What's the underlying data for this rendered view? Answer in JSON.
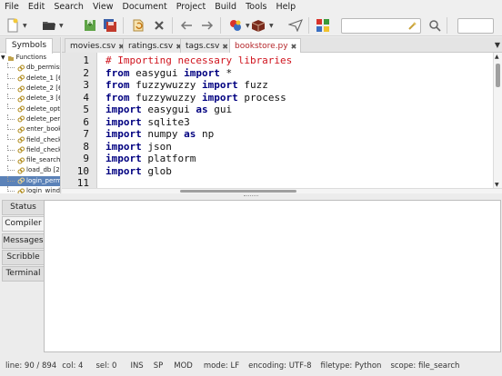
{
  "menubar": {
    "items": [
      "File",
      "Edit",
      "Search",
      "View",
      "Document",
      "Project",
      "Build",
      "Tools",
      "Help"
    ]
  },
  "toolbar": {
    "buttons": [
      "new-file-icon",
      "open-folder-icon",
      "save-icon",
      "save-all-icon",
      "revert-icon",
      "close-icon",
      "back-icon",
      "forward-icon",
      "compile-icon",
      "build-icon",
      "run-icon",
      "color-chooser-icon",
      "jump-to-icon"
    ],
    "search_value": ""
  },
  "sidebar": {
    "tab_label": "Symbols",
    "root_label": "Functions",
    "items": [
      "db_permiss",
      "delete_1 [6",
      "delete_2 [6",
      "delete_3 [6",
      "delete_optic",
      "delete_perm",
      "enter_book",
      "field_check",
      "field_check",
      "file_search",
      "load_db [26",
      "login_perm",
      "login_windo"
    ],
    "selected_index": 11
  },
  "editor_tabs": [
    {
      "label": "movies.csv",
      "active": false
    },
    {
      "label": "ratings.csv",
      "active": false
    },
    {
      "label": "tags.csv",
      "active": false
    },
    {
      "label": "bookstore.py",
      "active": true
    }
  ],
  "editor": {
    "line_numbers": [
      "1",
      "2",
      "3",
      "4",
      "5",
      "6",
      "7",
      "8",
      "9",
      "10",
      "11"
    ],
    "lines": [
      [
        {
          "t": "# Importing necessary libraries",
          "c": "cm"
        }
      ],
      [
        {
          "t": "from",
          "c": "kw"
        },
        {
          "t": " easygui ",
          "c": ""
        },
        {
          "t": "import",
          "c": "kw"
        },
        {
          "t": " *",
          "c": ""
        }
      ],
      [
        {
          "t": "from",
          "c": "kw"
        },
        {
          "t": " fuzzywuzzy ",
          "c": ""
        },
        {
          "t": "import",
          "c": "kw"
        },
        {
          "t": " fuzz",
          "c": ""
        }
      ],
      [
        {
          "t": "from",
          "c": "kw"
        },
        {
          "t": " fuzzywuzzy ",
          "c": ""
        },
        {
          "t": "import",
          "c": "kw"
        },
        {
          "t": " process",
          "c": ""
        }
      ],
      [
        {
          "t": "import",
          "c": "kw"
        },
        {
          "t": " easygui ",
          "c": ""
        },
        {
          "t": "as",
          "c": "kw"
        },
        {
          "t": " gui",
          "c": ""
        }
      ],
      [
        {
          "t": "import",
          "c": "kw"
        },
        {
          "t": " sqlite3",
          "c": ""
        }
      ],
      [
        {
          "t": "import",
          "c": "kw"
        },
        {
          "t": " numpy ",
          "c": ""
        },
        {
          "t": "as",
          "c": "kw"
        },
        {
          "t": " np",
          "c": ""
        }
      ],
      [
        {
          "t": "import",
          "c": "kw"
        },
        {
          "t": " json",
          "c": ""
        }
      ],
      [
        {
          "t": "import",
          "c": "kw"
        },
        {
          "t": " platform",
          "c": ""
        }
      ],
      [
        {
          "t": "import",
          "c": "kw"
        },
        {
          "t": " glob",
          "c": ""
        }
      ],
      []
    ]
  },
  "message_tabs": [
    {
      "label": "Status",
      "active": false
    },
    {
      "label": "Compiler",
      "active": true
    },
    {
      "label": "Messages",
      "active": false
    },
    {
      "label": "Scribble",
      "active": false
    },
    {
      "label": "Terminal",
      "active": false
    }
  ],
  "statusbar": {
    "line": "line: 90 / 894",
    "col": "col: 4",
    "sel": "sel: 0",
    "ins": "INS",
    "sp": "SP",
    "mod": "MOD",
    "mode": "mode: LF",
    "encoding": "encoding: UTF-8",
    "filetype": "filetype: Python",
    "scope": "scope: file_search"
  },
  "colors": {
    "keyword": "#000080",
    "comment": "#d0141e",
    "active_tab_text": "#b5272b",
    "selection": "#5b82b8"
  }
}
